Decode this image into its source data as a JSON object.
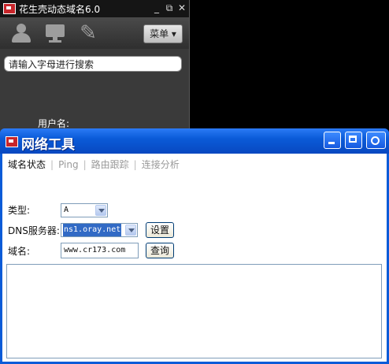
{
  "background_app": {
    "title": "花生壳动态域名6.0",
    "window_controls": [
      "_",
      "⧉",
      "✕"
    ],
    "menu_label": "菜单 ▾",
    "search_placeholder": "请输入字母进行搜索",
    "user_label": "用户名:",
    "icons": [
      "user-icon",
      "monitor-icon",
      "wrench-icon"
    ]
  },
  "dialog": {
    "title": "网络工具",
    "tabs": [
      "域名状态",
      "Ping",
      "路由跟踪",
      "连接分析"
    ],
    "active_tab": "域名状态",
    "type_label": "类型:",
    "type_value": "A",
    "dns_label": "DNS服务器:",
    "dns_value": "ns1.oray.net",
    "set_button": "设置",
    "domain_label": "域名:",
    "domain_value": "www.cr173.com",
    "query_button": "查询",
    "result_text": ""
  },
  "colors": {
    "titlebar": "#0a5bd8",
    "app_bg": "#3a3a3a",
    "selection": "#316ac5"
  }
}
